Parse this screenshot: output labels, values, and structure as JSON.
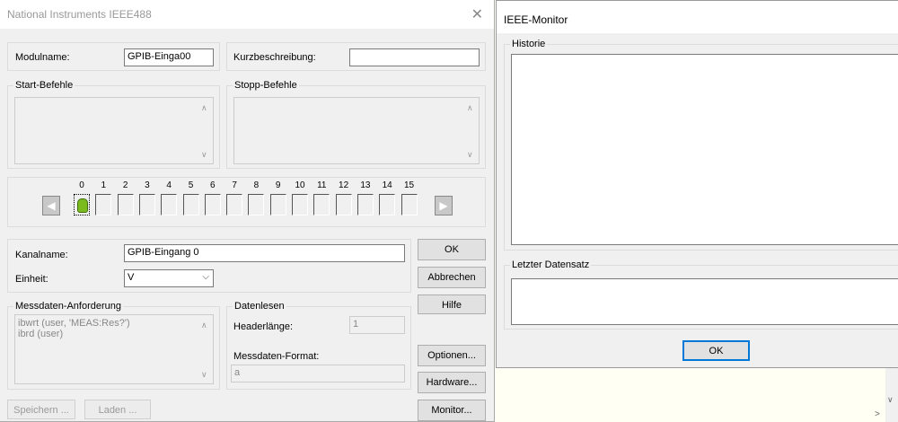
{
  "main_window": {
    "title": "National Instruments IEEE488",
    "close": "✕",
    "modulname_label": "Modulname:",
    "modulname_value": "GPIB-Einga00",
    "kurz_label": "Kurzbeschreibung:",
    "kurz_value": "",
    "start_label": "Start-Befehle",
    "stopp_label": "Stopp-Befehle",
    "channels": [
      "0",
      "1",
      "2",
      "3",
      "4",
      "5",
      "6",
      "7",
      "8",
      "9",
      "10",
      "11",
      "12",
      "13",
      "14",
      "15"
    ],
    "kanalname_label": "Kanalname:",
    "kanalname_value": "GPIB-Eingang 0",
    "einheit_label": "Einheit:",
    "einheit_value": "V",
    "messdaten_label": "Messdaten-Anforderung",
    "messdaten_line1": "ibwrt (user, 'MEAS:Res?')",
    "messdaten_line2": "ibrd (user)",
    "datenlesen_label": "Datenlesen",
    "headerlaenge_label": "Headerlänge:",
    "headerlaenge_value": "1",
    "format_label": "Messdaten-Format:",
    "format_value": "a",
    "buttons": {
      "ok": "OK",
      "abbrechen": "Abbrechen",
      "hilfe": "Hilfe",
      "optionen": "Optionen...",
      "hardware": "Hardware...",
      "monitor": "Monitor...",
      "speichern": "Speichern ...",
      "laden": "Laden ..."
    }
  },
  "monitor_window": {
    "title": "IEEE-Monitor",
    "historie_label": "Historie",
    "letzter_label": "Letzter Datensatz",
    "ok": "OK"
  }
}
